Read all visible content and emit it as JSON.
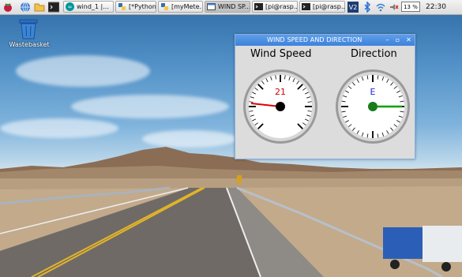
{
  "taskbar": {
    "buttons": [
      {
        "label": "wind_1 |..."
      },
      {
        "label": "[*Python..."
      },
      {
        "label": "[myMete..."
      },
      {
        "label": "WIND SP..."
      },
      {
        "label": "[pi@rasp..."
      },
      {
        "label": "[pi@rasp..."
      }
    ],
    "cpu": "13 %",
    "clock": "22:30"
  },
  "desktop": {
    "wastebasket_label": "Wastebasket"
  },
  "window": {
    "title": "WIND SPEED AND DIRECTION",
    "min_glyph": "–",
    "max_glyph": "▫",
    "close_glyph": "✕",
    "speed": {
      "title": "Wind Speed",
      "value": "21",
      "value_color": "#d40000",
      "needle_color": "#e00000"
    },
    "direction": {
      "title": "Direction",
      "value": "E",
      "value_color": "#2222dd",
      "needle_color": "#00a000"
    }
  }
}
